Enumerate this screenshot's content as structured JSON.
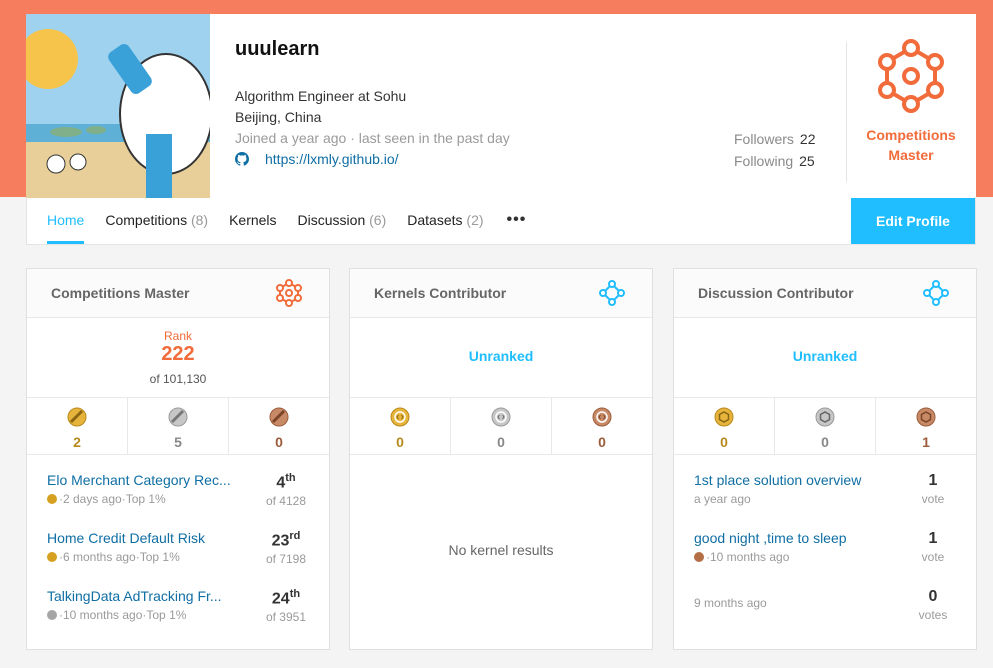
{
  "profile": {
    "username": "uuulearn",
    "occupation": "Algorithm Engineer at Sohu",
    "location": "Beijing, China",
    "joined": "Joined a year ago · last seen in the past day",
    "github_url": "https://lxmly.github.io/",
    "followers_label": "Followers",
    "followers_count": "22",
    "following_label": "Following",
    "following_count": "25",
    "tier_line1": "Competitions",
    "tier_line2": "Master"
  },
  "nav": {
    "tabs": [
      {
        "label": "Home",
        "count": ""
      },
      {
        "label": "Competitions",
        "count": "(8)"
      },
      {
        "label": "Kernels",
        "count": ""
      },
      {
        "label": "Discussion",
        "count": "(6)"
      },
      {
        "label": "Datasets",
        "count": "(2)"
      }
    ],
    "more": "•••",
    "edit_profile": "Edit Profile"
  },
  "panels": {
    "competitions": {
      "title": "Competitions Master",
      "rank_label": "Rank",
      "rank": "222",
      "rank_of": "of 101,130",
      "medals": {
        "gold": "2",
        "silver": "5",
        "bronze": "0"
      },
      "items": [
        {
          "title": "Elo Merchant Category Rec...",
          "sub": "·2 days ago·Top 1%",
          "medal": "gold",
          "place": "4",
          "suffix": "th",
          "of": "of 4128"
        },
        {
          "title": "Home Credit Default Risk",
          "sub": "·6 months ago·Top 1%",
          "medal": "gold",
          "place": "23",
          "suffix": "rd",
          "of": "of 7198"
        },
        {
          "title": "TalkingData AdTracking Fr...",
          "sub": "·10 months ago·Top 1%",
          "medal": "silver",
          "place": "24",
          "suffix": "th",
          "of": "of 3951"
        }
      ]
    },
    "kernels": {
      "title": "Kernels Contributor",
      "status": "Unranked",
      "medals": {
        "gold": "0",
        "silver": "0",
        "bronze": "0"
      },
      "empty": "No kernel results"
    },
    "discussion": {
      "title": "Discussion Contributor",
      "status": "Unranked",
      "medals": {
        "gold": "0",
        "silver": "0",
        "bronze": "1"
      },
      "items": [
        {
          "title": "1st place solution overview",
          "sub": "a year ago",
          "medal": "",
          "votes": "1",
          "votes_label": "vote"
        },
        {
          "title": "good night ,time to sleep",
          "sub": "·10 months ago",
          "medal": "bronze",
          "votes": "1",
          "votes_label": "vote"
        },
        {
          "title": "",
          "sub": "9 months ago",
          "medal": "",
          "votes": "0",
          "votes_label": "votes"
        }
      ]
    }
  },
  "colors": {
    "accent": "#20beff",
    "master": "#f26b3a",
    "banner": "#f67e5f",
    "gold": "#d6a020",
    "silver": "#a6a6a6",
    "bronze": "#b46e46"
  }
}
